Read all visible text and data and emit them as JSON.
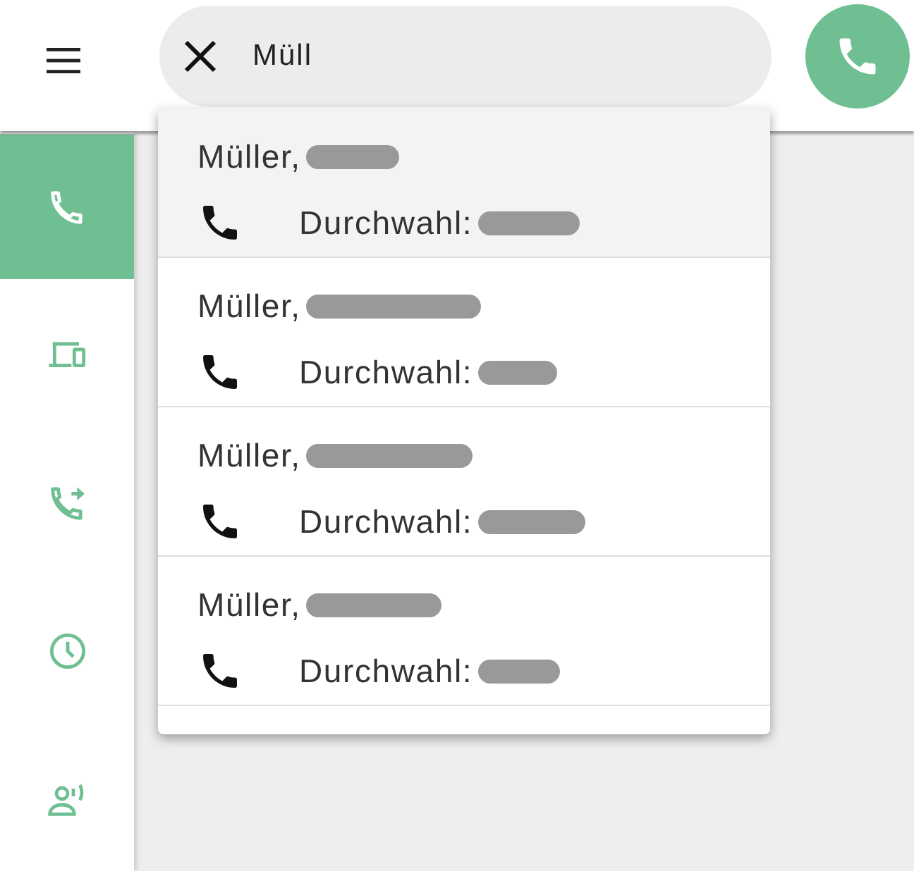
{
  "search": {
    "value": "Müll"
  },
  "sidebar": {
    "items": [
      {
        "kind": "phone",
        "selected": true
      },
      {
        "kind": "devices",
        "selected": false
      },
      {
        "kind": "forward",
        "selected": false
      },
      {
        "kind": "history",
        "selected": false
      },
      {
        "kind": "presence",
        "selected": false
      }
    ]
  },
  "results": [
    {
      "name": "Müller,",
      "extension": "Durchwahl:",
      "selected": true
    },
    {
      "name": "Müller,",
      "extension": "Durchwahl:",
      "selected": false
    },
    {
      "name": "Müller,",
      "extension": "Durchwahl:",
      "selected": false
    },
    {
      "name": "Müller,",
      "extension": "Durchwahl:",
      "selected": false
    }
  ]
}
